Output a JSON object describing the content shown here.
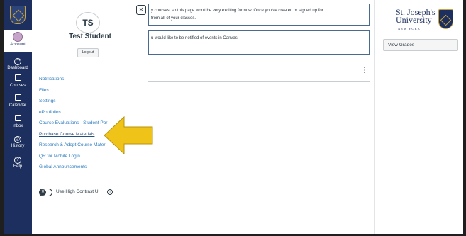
{
  "global_nav": {
    "items": [
      {
        "label": "Account",
        "icon": "user-avatar-icon"
      },
      {
        "label": "Dashboard",
        "icon": "dashboard-icon"
      },
      {
        "label": "Courses",
        "icon": "book-icon"
      },
      {
        "label": "Calendar",
        "icon": "calendar-icon"
      },
      {
        "label": "Inbox",
        "icon": "inbox-icon"
      },
      {
        "label": "History",
        "icon": "clock-icon"
      },
      {
        "label": "Help",
        "icon": "help-icon"
      }
    ]
  },
  "account_tray": {
    "initials": "TS",
    "name": "Test Student",
    "logout_label": "Logout",
    "links": [
      "Notifications",
      "Files",
      "Settings",
      "ePortfolios",
      "Course Evaluations - Student Por",
      "Purchase Course Materials",
      "Research & Adopt Course Mater",
      "QR for Mobile Login",
      "Global Announcements"
    ],
    "high_contrast_label": "Use High Contrast UI",
    "close_icon": "close-icon"
  },
  "main": {
    "notice_1_line_1": "y courses, so this page won't be very exciting for now. Once you've created or signed up for",
    "notice_1_line_2": "from all of your classes.",
    "notice_2_text": "u would like to be notified of events in Canvas.",
    "menu_glyph": "⋮"
  },
  "sidebar": {
    "brand_line_1": "St. Joseph's",
    "brand_line_2": "University",
    "brand_line_3": "NEW YORK",
    "view_grades_label": "View Grades"
  },
  "colors": {
    "nav_blue": "#1d2f5e",
    "link_blue": "#2b7abc",
    "arrow_yellow": "#f0c319",
    "brand_gold": "#c9a33b"
  }
}
